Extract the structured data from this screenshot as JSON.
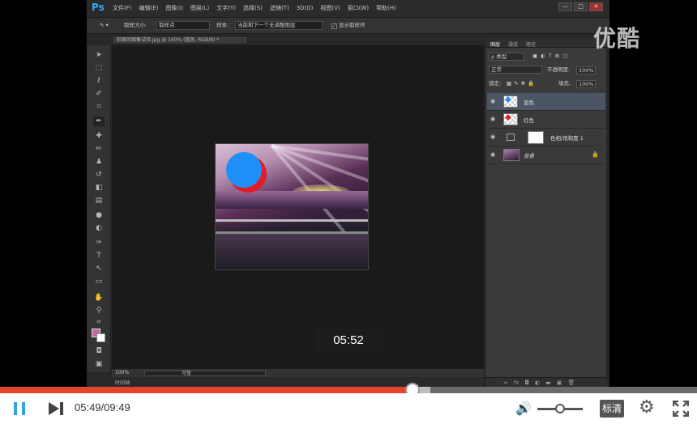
{
  "photoshop": {
    "logo": "Ps",
    "menus": [
      "文件(F)",
      "编辑(E)",
      "图像(I)",
      "图层(L)",
      "文字(Y)",
      "选择(S)",
      "滤镜(T)",
      "3D(D)",
      "视图(V)",
      "窗口(W)",
      "帮助(H)"
    ],
    "window_buttons": [
      "—",
      "□",
      "✕"
    ],
    "options": {
      "sample_size_label": "取样大小:",
      "sample_size_value": "取样点",
      "sample_label": "样本:",
      "sample_value": "当前和下一个无调整图层",
      "show_ring_label": "显示取样环"
    },
    "document_tab": "彩图的图像试验.jpg @ 100% (蓝色, RGB/8) *",
    "status": {
      "zoom": "100%",
      "scroll_label": "可整"
    },
    "timeline_label": "时间轴",
    "foreground_color": "#bd6aa0",
    "background_color": "#ffffff"
  },
  "artwork": {
    "blue_circle_color": "#1e8ff6",
    "red_circle_color": "#e21c28"
  },
  "layers_panel": {
    "tabs": [
      "图层",
      "通道",
      "路径"
    ],
    "kind_filter": "ρ 类型",
    "blend_mode": "正常",
    "opacity_label": "不透明度:",
    "opacity_value": "100%",
    "lock_label": "锁定:",
    "fill_label": "填充:",
    "fill_value": "100%",
    "layers": [
      {
        "name": "蓝色",
        "selected": true
      },
      {
        "name": "红色",
        "selected": false
      },
      {
        "name": "色相/饱和度 1",
        "selected": false
      },
      {
        "name": "背景",
        "selected": false
      }
    ]
  },
  "watermark": "优酷",
  "overlay_time": "05:52",
  "player": {
    "current_time": "05:49",
    "total_time": "09:49",
    "time_display": "05:49/09:49",
    "progress_fraction": 0.592,
    "buffered_fraction": 0.617,
    "volume_fraction": 0.5,
    "quality_label": "标清",
    "accent_color": "#e4452a",
    "play_icon_color": "#2ea3e6"
  }
}
